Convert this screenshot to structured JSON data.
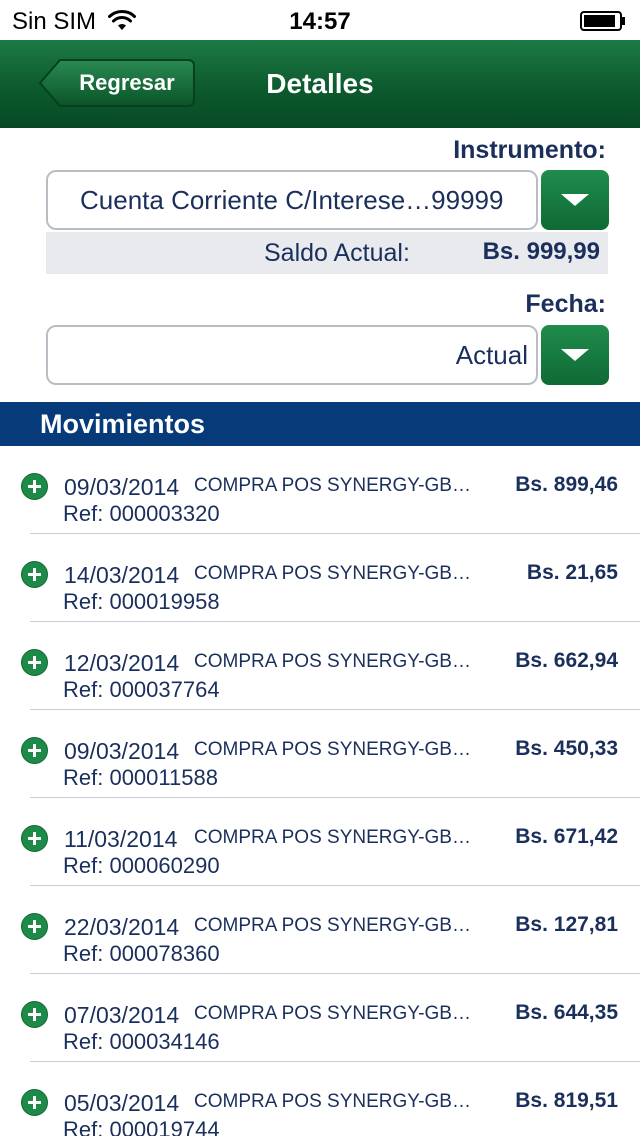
{
  "status_bar": {
    "carrier": "Sin SIM",
    "time": "14:57"
  },
  "nav": {
    "back_label": "Regresar",
    "title": "Detalles"
  },
  "instrument": {
    "label": "Instrumento:",
    "value": "Cuenta Corriente C/Interese…99999"
  },
  "balance": {
    "label": "Saldo Actual:",
    "value": "Bs. 999,99"
  },
  "date_filter": {
    "label": "Fecha:",
    "value": "Actual"
  },
  "movements": {
    "title": "Movimientos",
    "items": [
      {
        "date": "09/03/2014",
        "description": "COMPRA POS SYNERGY-GB…",
        "amount": "Bs. 899,46",
        "ref": "Ref: 000003320"
      },
      {
        "date": "14/03/2014",
        "description": "COMPRA POS SYNERGY-GB…",
        "amount": "Bs. 21,65",
        "ref": "Ref: 000019958"
      },
      {
        "date": "12/03/2014",
        "description": "COMPRA POS SYNERGY-GB…",
        "amount": "Bs. 662,94",
        "ref": "Ref: 000037764"
      },
      {
        "date": "09/03/2014",
        "description": "COMPRA POS SYNERGY-GB…",
        "amount": "Bs. 450,33",
        "ref": "Ref: 000011588"
      },
      {
        "date": "11/03/2014",
        "description": "COMPRA POS SYNERGY-GB…",
        "amount": "Bs. 671,42",
        "ref": "Ref: 000060290"
      },
      {
        "date": "22/03/2014",
        "description": "COMPRA POS SYNERGY-GB…",
        "amount": "Bs. 127,81",
        "ref": "Ref: 000078360"
      },
      {
        "date": "07/03/2014",
        "description": "COMPRA POS SYNERGY-GB…",
        "amount": "Bs. 644,35",
        "ref": "Ref: 000034146"
      },
      {
        "date": "05/03/2014",
        "description": "COMPRA POS SYNERGY-GB…",
        "amount": "Bs. 819,51",
        "ref": "Ref: 000019744"
      }
    ]
  },
  "colors": {
    "nav_green": "#0d5a2e",
    "accent_green": "#1d8a47",
    "header_blue": "#073a78",
    "text_navy": "#1b2f5c"
  },
  "icons": [
    "wifi-icon",
    "battery-icon",
    "back-arrow-icon",
    "dropdown-arrow-icon",
    "plus-circle-icon"
  ]
}
